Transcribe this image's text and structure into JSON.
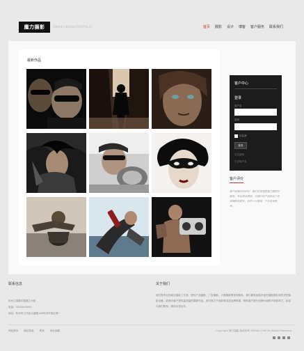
{
  "header": {
    "logo": "魔力摄影",
    "tagline": "ONYAKI-IDGISH PORFOLIO",
    "nav": [
      {
        "label": "首页",
        "active": true
      },
      {
        "label": "摄影",
        "active": false
      },
      {
        "label": "设计",
        "active": false
      },
      {
        "label": "博客",
        "active": false
      },
      {
        "label": "客户服务",
        "active": false
      },
      {
        "label": "联系我们",
        "active": false
      }
    ]
  },
  "gallery": {
    "title": "最新作品",
    "images": [
      "two-men-sunglasses-photo",
      "figure-in-alley-photo",
      "woman-face-portrait-photo",
      "feather-woman-photo",
      "man-sunglasses-car-photo",
      "masked-woman-photo",
      "motorbike-ride-photo",
      "person-with-bottle-photo",
      "man-with-speaker-photo"
    ]
  },
  "sidebar": {
    "title": "客户中心",
    "login": "登录",
    "username_label": "用户名",
    "password_label": "密码",
    "remember": "记住我",
    "button": "登录",
    "links": [
      "忘记密码",
      "忘记用户名"
    ]
  },
  "testimonial": {
    "title": "客户评价",
    "text": "客户给我们的评价：我们非常满意魔力摄影的服务，专业而且高效，为我们的产品拍出了非常精彩的照片，合作十分愉快，下次还会再来。"
  },
  "footer": {
    "contact_title": "联系信息",
    "contact_lines": [
      "杭州江南路中国路工大街",
      "电话：0000000000",
      "地址：杭州市工作区大道路168号中环某区第一"
    ],
    "about_title": "关于我们",
    "about_text": "我们是专业的商业摄影工作室，提供产品摄影、广告摄影、人像摄影等多项服务。我们拥有经验丰富的摄影团队和先进的摄影设备，能够为客户提供高质量的摄影作品。我们致力于用影像讲述品牌故事，帮助客户提升品牌价值和市场影响力。欢迎与我们联系，期待与您合作。",
    "links": [
      "网站首页",
      "网站导航",
      "联系",
      "商业摄影"
    ],
    "copyright": "Copyright 魔力摄影 版权所有 ONYAKI.COM All Rights Reserved"
  },
  "colors": {
    "accent": "#c0392b",
    "dark": "#1c1c1c",
    "page_bg": "#e9e9e9"
  }
}
